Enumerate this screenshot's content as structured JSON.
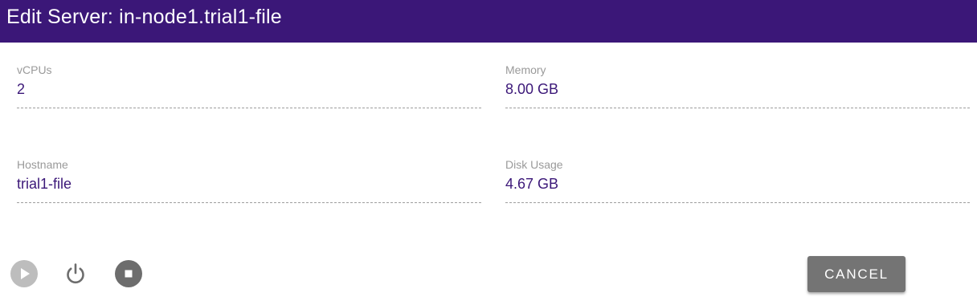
{
  "header": {
    "title": "Edit Server: in-node1.trial1-file"
  },
  "fields": {
    "vcpus": {
      "label": "vCPUs",
      "value": "2"
    },
    "memory": {
      "label": "Memory",
      "value": "8.00 GB"
    },
    "hostname": {
      "label": "Hostname",
      "value": "trial1-file"
    },
    "disk_usage": {
      "label": "Disk Usage",
      "value": "4.67 GB"
    }
  },
  "actions": {
    "start_icon": "play-icon",
    "power_icon": "power-icon",
    "stop_icon": "stop-icon",
    "cancel_label": "CANCEL"
  },
  "colors": {
    "header_bg": "#3b1778",
    "value_text": "#3b1778",
    "label_text": "#9a9a9a",
    "cancel_bg": "#747474",
    "start_disabled": "#bdbdbd",
    "stop_bg": "#6d6d6d"
  }
}
